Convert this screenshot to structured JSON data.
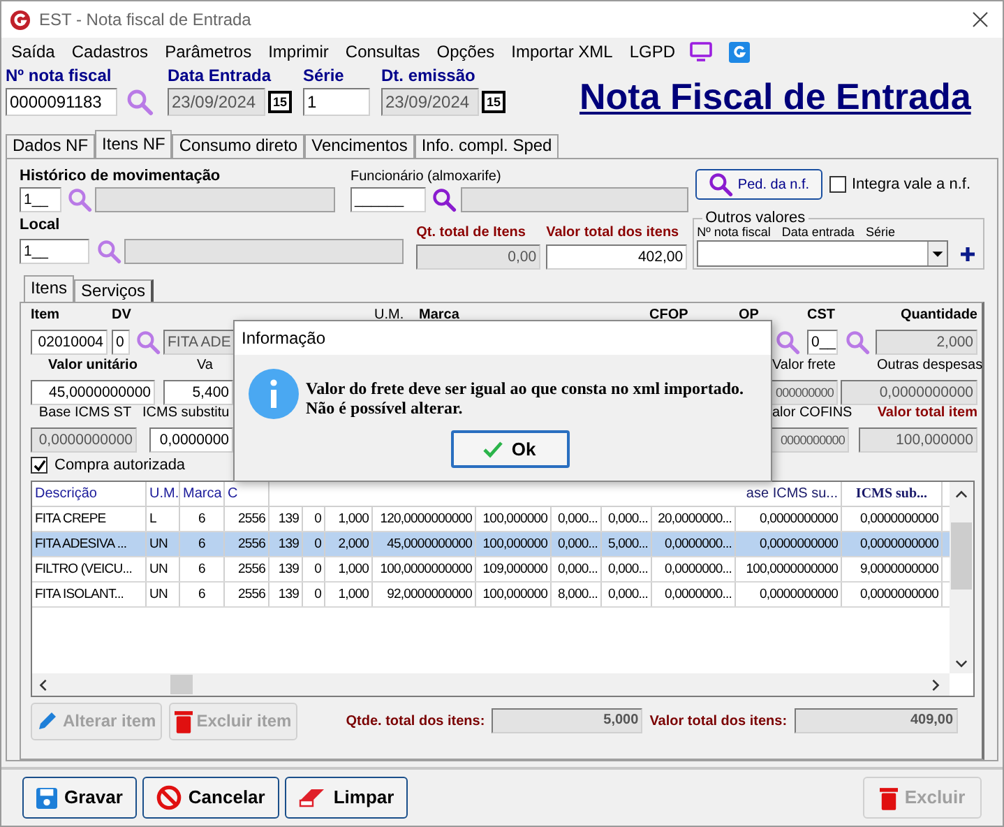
{
  "window": {
    "title": "EST - Nota fiscal de Entrada"
  },
  "menu": [
    "Saída",
    "Cadastros",
    "Parâmetros",
    "Imprimir",
    "Consultas",
    "Opções",
    "Importar XML",
    "LGPD"
  ],
  "header": {
    "fields": [
      {
        "label": "Nº nota fiscal",
        "value": "0000091183",
        "kind": "search"
      },
      {
        "label": "Data Entrada",
        "value": "23/09/2024",
        "kind": "date",
        "button_text": "15"
      },
      {
        "label": "Série",
        "value": "1",
        "kind": "plain"
      },
      {
        "label": "Dt. emissão",
        "value": "23/09/2024",
        "kind": "date",
        "button_text": "15"
      }
    ],
    "heading": "Nota Fiscal de Entrada"
  },
  "tabs": [
    {
      "label": "Dados NF",
      "selected": false
    },
    {
      "label": "Itens NF",
      "selected": true
    },
    {
      "label": "Consumo direto",
      "selected": false
    },
    {
      "label": "Vencimentos",
      "selected": false
    },
    {
      "label": "Info. compl. Sped",
      "selected": false
    }
  ],
  "movement": {
    "label": "Histórico de movimentação",
    "code": "1__"
  },
  "employee": {
    "label": "Funcionário (almoxarife)",
    "code": "______"
  },
  "order_button": {
    "label": "Ped. da n.f."
  },
  "integrate": {
    "label": "Integra vale a n.f.",
    "checked": false
  },
  "location": {
    "label": "Local",
    "code": "1__"
  },
  "totals_top": [
    {
      "label": "Qt. total de Itens",
      "value": "0,00",
      "readonly": true
    },
    {
      "label": "Valor total dos itens",
      "value": "402,00",
      "readonly": false
    }
  ],
  "other_values": {
    "title": "Outros valores",
    "columns": [
      "Nº nota fiscal",
      "Data entrada",
      "Série"
    ]
  },
  "item_tabs": [
    {
      "label": "Itens",
      "selected": true
    },
    {
      "label": "Serviços",
      "selected": false
    }
  ],
  "item_rows": [
    {
      "labels": [
        {
          "text": "Item",
          "kind": "bold"
        },
        {
          "text": "DV",
          "kind": "bold"
        },
        {
          "text": "U.M.",
          "kind": "plain"
        },
        {
          "text": "Marca",
          "kind": "bold"
        },
        {
          "text": "CFOP",
          "kind": "bold"
        },
        {
          "text": "OP",
          "kind": "bold"
        },
        {
          "text": "CST",
          "kind": "bold"
        },
        {
          "text": "Quantidade",
          "kind": "bold"
        }
      ],
      "left": [
        {
          "kind": "field",
          "value": "02010004",
          "readonly": false
        },
        {
          "kind": "field",
          "value": "0",
          "readonly": false
        },
        {
          "kind": "search"
        },
        {
          "kind": "field",
          "value": "FITA ADE",
          "readonly": true
        }
      ],
      "right": [
        {
          "kind": "search"
        },
        {
          "kind": "field",
          "value": "0__",
          "readonly": false
        },
        {
          "kind": "search"
        },
        {
          "kind": "field",
          "value": "2,000",
          "readonly": true
        }
      ]
    },
    {
      "labels": [
        {
          "text": "Valor unitário",
          "kind": "bold"
        },
        {
          "text": "Va",
          "kind": "plain"
        },
        {
          "text": "Valor frete",
          "kind": "plain"
        },
        {
          "text": "Outras despesas",
          "kind": "plain"
        }
      ],
      "left": [
        {
          "kind": "field",
          "value": "45,0000000000",
          "readonly": false
        },
        {
          "kind": "field",
          "value": "5,400",
          "readonly": false
        }
      ],
      "right": [
        {
          "kind": "field",
          "value": "000000000",
          "readonly": true
        },
        {
          "kind": "field",
          "value": "0,0000000000",
          "readonly": true
        }
      ]
    },
    {
      "labels": [
        {
          "text": "Base ICMS ST",
          "kind": "plain"
        },
        {
          "text": "ICMS substitu",
          "kind": "plain"
        },
        {
          "text": "alor COFINS",
          "kind": "plain"
        },
        {
          "text": "Valor total item",
          "kind": "red"
        }
      ],
      "left": [
        {
          "kind": "field",
          "value": "0,0000000000",
          "readonly": true
        },
        {
          "kind": "field",
          "value": "0,0000000",
          "readonly": false
        }
      ],
      "right": [
        {
          "kind": "field",
          "value": "0000000000",
          "readonly": true
        },
        {
          "kind": "field",
          "value": "100,000000",
          "readonly": true
        }
      ]
    }
  ],
  "authorized": {
    "label": "Compra autorizada",
    "checked": true
  },
  "table": {
    "columns_left": [
      "Descrição",
      "U.M.",
      "Marca",
      "C"
    ],
    "columns_right": [
      "ase ICMS su...",
      "ICMS sub..."
    ],
    "rows": [
      {
        "selected": false,
        "cells": [
          "FITA CREPE",
          "L",
          "6",
          "2556",
          "139",
          "0",
          "1,000",
          "120,0000000000",
          "100,000000",
          "0,000...",
          "0,000...",
          "20,0000000...",
          "0,0000000000",
          "0,0000000000"
        ]
      },
      {
        "selected": true,
        "cells": [
          "FITA ADESIVA ...",
          "UN",
          "6",
          "2556",
          "139",
          "0",
          "2,000",
          "45,0000000000",
          "100,000000",
          "0,000...",
          "5,000...",
          "0,0000000...",
          "0,0000000000",
          "0,0000000000"
        ]
      },
      {
        "selected": false,
        "cells": [
          "FILTRO (VEICU...",
          "UN",
          "6",
          "2556",
          "139",
          "0",
          "1,000",
          "100,0000000000",
          "109,000000",
          "0,000...",
          "0,000...",
          "0,0000000...",
          "100,0000000000",
          "9,0000000000"
        ]
      },
      {
        "selected": false,
        "cells": [
          "FITA ISOLANT...",
          "UN",
          "6",
          "2556",
          "139",
          "0",
          "1,000",
          "92,0000000000",
          "100,000000",
          "8,000...",
          "0,000...",
          "0,0000000...",
          "0,0000000000",
          "0,0000000000"
        ]
      }
    ]
  },
  "item_buttons": [
    {
      "label": "Alterar item",
      "disabled": true
    },
    {
      "label": "Excluir item",
      "disabled": true
    }
  ],
  "item_totals": [
    {
      "label": "Qtde. total dos itens:",
      "value": "5,000"
    },
    {
      "label": "Valor total dos itens:",
      "value": "409,00"
    }
  ],
  "footer_buttons": [
    {
      "label": "Gravar",
      "disabled": false
    },
    {
      "label": "Cancelar",
      "disabled": false
    },
    {
      "label": "Limpar",
      "disabled": false
    }
  ],
  "delete_button": {
    "label": "Excluir",
    "disabled": true
  },
  "dialog": {
    "title": "Informação",
    "lines": [
      "Valor do frete deve ser igual ao que consta no xml importado.",
      "Não é possível alterar."
    ],
    "button": "Ok"
  }
}
